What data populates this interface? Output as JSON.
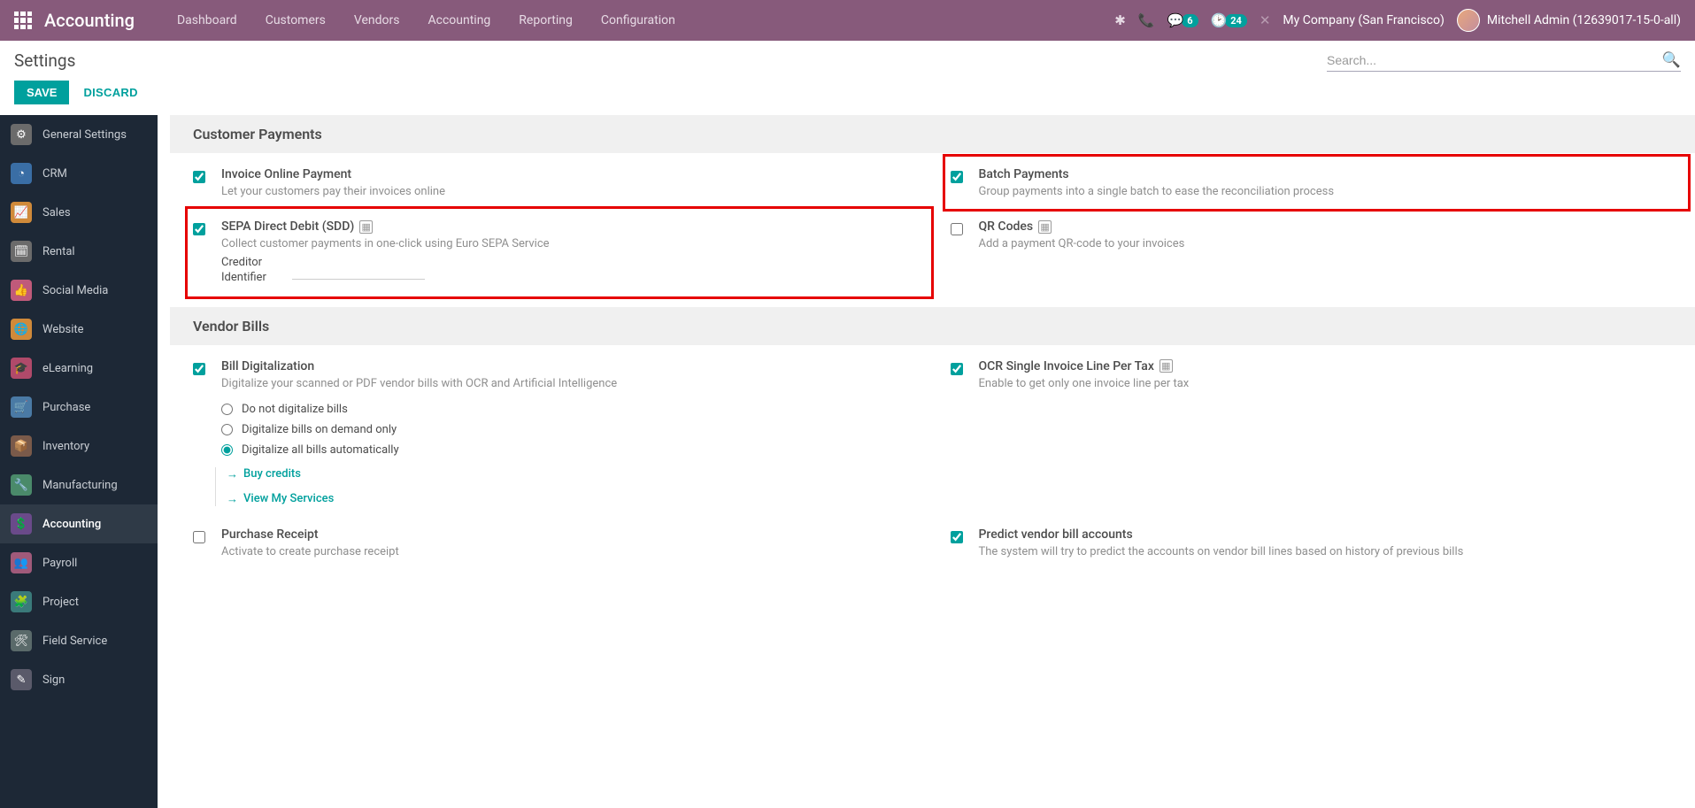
{
  "colors": {
    "accent": "#00a09d",
    "nav_bg": "#875a7b",
    "sidebar_bg": "#1d2836"
  },
  "header": {
    "brand": "Accounting",
    "nav": [
      "Dashboard",
      "Customers",
      "Vendors",
      "Accounting",
      "Reporting",
      "Configuration"
    ],
    "badges": {
      "messages": "6",
      "activities": "24"
    },
    "company": "My Company (San Francisco)",
    "user": "Mitchell Admin (12639017-15-0-all)"
  },
  "page": {
    "title": "Settings",
    "search_placeholder": "Search...",
    "save": "SAVE",
    "discard": "DISCARD"
  },
  "sidebar": [
    {
      "label": "General Settings",
      "bg": "#6b6b6b",
      "glyph": "⚙"
    },
    {
      "label": "CRM",
      "bg": "#3a6ea5",
      "glyph": "◔"
    },
    {
      "label": "Sales",
      "bg": "#d08a3a",
      "glyph": "📈"
    },
    {
      "label": "Rental",
      "bg": "#6b6b6b",
      "glyph": "🗓"
    },
    {
      "label": "Social Media",
      "bg": "#c05a7a",
      "glyph": "👍"
    },
    {
      "label": "Website",
      "bg": "#d08a3a",
      "glyph": "🌐"
    },
    {
      "label": "eLearning",
      "bg": "#b04a6a",
      "glyph": "🎓"
    },
    {
      "label": "Purchase",
      "bg": "#4a7aa5",
      "glyph": "🛒"
    },
    {
      "label": "Inventory",
      "bg": "#7a5a4a",
      "glyph": "📦"
    },
    {
      "label": "Manufacturing",
      "bg": "#4a8a6a",
      "glyph": "🔧"
    },
    {
      "label": "Accounting",
      "bg": "#6a4a8a",
      "glyph": "💲",
      "active": true
    },
    {
      "label": "Payroll",
      "bg": "#a05a7a",
      "glyph": "👥"
    },
    {
      "label": "Project",
      "bg": "#3a7a7a",
      "glyph": "🧩"
    },
    {
      "label": "Field Service",
      "bg": "#5a6a6a",
      "glyph": "🛠"
    },
    {
      "label": "Sign",
      "bg": "#5a5a6a",
      "glyph": "✎"
    }
  ],
  "sections": {
    "customer_payments": {
      "title": "Customer Payments",
      "settings": {
        "invoice_online": {
          "label": "Invoice Online Payment",
          "desc": "Let your customers pay their invoices online",
          "checked": true
        },
        "batch_payments": {
          "label": "Batch Payments",
          "desc": "Group payments into a single batch to ease the reconciliation process",
          "checked": true
        },
        "sepa": {
          "label": "SEPA Direct Debit (SDD)",
          "desc": "Collect customer payments in one-click using Euro SEPA Service",
          "checked": true,
          "creditor_label": "Creditor Identifier",
          "creditor_value": ""
        },
        "qr_codes": {
          "label": "QR Codes",
          "desc": "Add a payment QR-code to your invoices",
          "checked": false
        }
      }
    },
    "vendor_bills": {
      "title": "Vendor Bills",
      "settings": {
        "digitize": {
          "label": "Bill Digitalization",
          "desc": "Digitalize your scanned or PDF vendor bills with OCR and Artificial Intelligence",
          "checked": true,
          "options": {
            "none": "Do not digitalize bills",
            "demand": "Digitalize bills on demand only",
            "auto": "Digitalize all bills automatically"
          },
          "selected": "auto",
          "link_buy": "Buy credits",
          "link_services": "View My Services"
        },
        "ocr_single": {
          "label": "OCR Single Invoice Line Per Tax",
          "desc": "Enable to get only one invoice line per tax",
          "checked": true
        },
        "purchase_receipt": {
          "label": "Purchase Receipt",
          "desc": "Activate to create purchase receipt",
          "checked": false
        },
        "predict": {
          "label": "Predict vendor bill accounts",
          "desc": "The system will try to predict the accounts on vendor bill lines based on history of previous bills",
          "checked": true
        }
      }
    }
  }
}
